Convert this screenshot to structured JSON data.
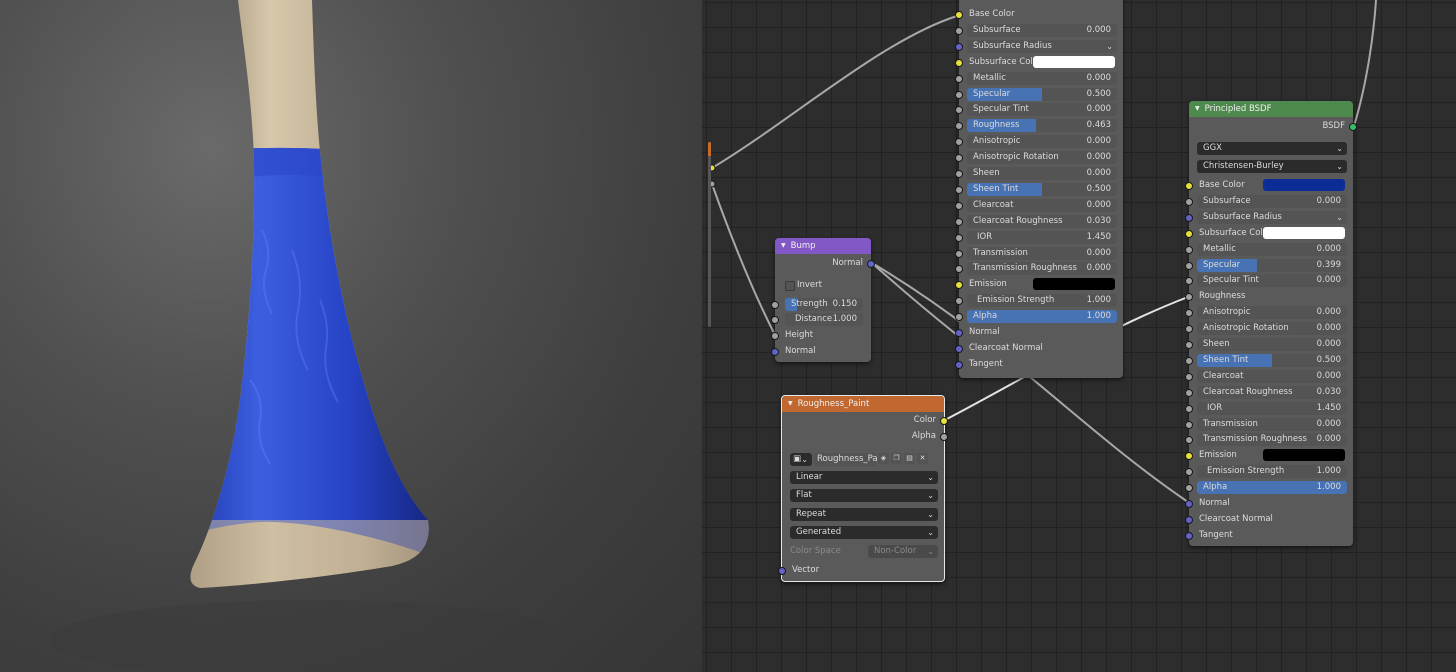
{
  "colors": {
    "bump_header": "#8257c6",
    "roughness_header": "#c0682f",
    "principled_header": "#4e8a4e",
    "accent_fill": "#4772b3",
    "base_color_swatch": "#0d2d96"
  },
  "principled_left": {
    "rows": [
      {
        "label": "Base Color",
        "socket": "yellow",
        "kind": "socket"
      },
      {
        "label": "Subsurface",
        "value": "0.000",
        "socket": "gray",
        "kind": "field",
        "fill": 0
      },
      {
        "label": "Subsurface Radius",
        "socket": "purple",
        "kind": "dropdown"
      },
      {
        "label": "Subsurface Col",
        "socket": "yellow",
        "kind": "color",
        "color": "#ffffff"
      },
      {
        "label": "Metallic",
        "value": "0.000",
        "socket": "gray",
        "kind": "field",
        "fill": 0
      },
      {
        "label": "Specular",
        "value": "0.500",
        "socket": "gray",
        "kind": "field",
        "fill": 0.5
      },
      {
        "label": "Specular Tint",
        "value": "0.000",
        "socket": "gray",
        "kind": "field",
        "fill": 0
      },
      {
        "label": "Roughness",
        "value": "0.463",
        "socket": "gray",
        "kind": "field",
        "fill": 0.463
      },
      {
        "label": "Anisotropic",
        "value": "0.000",
        "socket": "gray",
        "kind": "field",
        "fill": 0
      },
      {
        "label": "Anisotropic Rotation",
        "value": "0.000",
        "socket": "gray",
        "kind": "field",
        "fill": 0
      },
      {
        "label": "Sheen",
        "value": "0.000",
        "socket": "gray",
        "kind": "field",
        "fill": 0
      },
      {
        "label": "Sheen Tint",
        "value": "0.500",
        "socket": "gray",
        "kind": "field",
        "fill": 0.5
      },
      {
        "label": "Clearcoat",
        "value": "0.000",
        "socket": "gray",
        "kind": "field",
        "fill": 0
      },
      {
        "label": "Clearcoat Roughness",
        "value": "0.030",
        "socket": "gray",
        "kind": "field",
        "fill": 0
      },
      {
        "label": "IOR",
        "value": "1.450",
        "socket": "gray",
        "kind": "field",
        "fill": 0
      },
      {
        "label": "Transmission",
        "value": "0.000",
        "socket": "gray",
        "kind": "field",
        "fill": 0
      },
      {
        "label": "Transmission Roughness",
        "value": "0.000",
        "socket": "gray",
        "kind": "field",
        "fill": 0
      },
      {
        "label": "Emission",
        "socket": "yellow",
        "kind": "color",
        "color": "#000000"
      },
      {
        "label": "Emission Strength",
        "value": "1.000",
        "socket": "gray",
        "kind": "field",
        "fill": 0
      },
      {
        "label": "Alpha",
        "value": "1.000",
        "socket": "gray",
        "kind": "field",
        "fill": 1
      },
      {
        "label": "Normal",
        "socket": "purple",
        "kind": "socket"
      },
      {
        "label": "Clearcoat Normal",
        "socket": "purple",
        "kind": "socket"
      },
      {
        "label": "Tangent",
        "socket": "purple",
        "kind": "socket"
      }
    ]
  },
  "bump": {
    "title": "Bump",
    "output_normal": "Normal",
    "invert": "Invert",
    "strength_label": "Strength",
    "strength_value": "0.150",
    "strength_fill": 0.15,
    "distance_label": "Distance",
    "distance_value": "1.000",
    "height": "Height",
    "normal": "Normal"
  },
  "roughness_paint": {
    "title": "Roughness_Paint",
    "output_color": "Color",
    "output_alpha": "Alpha",
    "image_name": "Roughness_Pai..",
    "interpolation": "Linear",
    "projection": "Flat",
    "extension": "Repeat",
    "source": "Generated",
    "color_space_label": "Color Space",
    "color_space_value": "Non-Color",
    "vector": "Vector"
  },
  "principled_right": {
    "title": "Principled BSDF",
    "output": "BSDF",
    "distribution": "GGX",
    "subsurface_method": "Christensen-Burley",
    "rows": [
      {
        "label": "Base Color",
        "socket": "yellow",
        "kind": "color",
        "color": "#0d2d96"
      },
      {
        "label": "Subsurface",
        "value": "0.000",
        "socket": "gray",
        "kind": "field",
        "fill": 0
      },
      {
        "label": "Subsurface Radius",
        "socket": "purple",
        "kind": "dropdown"
      },
      {
        "label": "Subsurface Col",
        "socket": "yellow",
        "kind": "color",
        "color": "#ffffff"
      },
      {
        "label": "Metallic",
        "value": "0.000",
        "socket": "gray",
        "kind": "field",
        "fill": 0
      },
      {
        "label": "Specular",
        "value": "0.399",
        "socket": "gray",
        "kind": "field",
        "fill": 0.399
      },
      {
        "label": "Specular Tint",
        "value": "0.000",
        "socket": "gray",
        "kind": "field",
        "fill": 0
      },
      {
        "label": "Roughness",
        "socket": "gray",
        "kind": "socket"
      },
      {
        "label": "Anisotropic",
        "value": "0.000",
        "socket": "gray",
        "kind": "field",
        "fill": 0
      },
      {
        "label": "Anisotropic Rotation",
        "value": "0.000",
        "socket": "gray",
        "kind": "field",
        "fill": 0
      },
      {
        "label": "Sheen",
        "value": "0.000",
        "socket": "gray",
        "kind": "field",
        "fill": 0
      },
      {
        "label": "Sheen Tint",
        "value": "0.500",
        "socket": "gray",
        "kind": "field",
        "fill": 0.5
      },
      {
        "label": "Clearcoat",
        "value": "0.000",
        "socket": "gray",
        "kind": "field",
        "fill": 0
      },
      {
        "label": "Clearcoat Roughness",
        "value": "0.030",
        "socket": "gray",
        "kind": "field",
        "fill": 0
      },
      {
        "label": "IOR",
        "value": "1.450",
        "socket": "gray",
        "kind": "field",
        "fill": 0
      },
      {
        "label": "Transmission",
        "value": "0.000",
        "socket": "gray",
        "kind": "field",
        "fill": 0
      },
      {
        "label": "Transmission Roughness",
        "value": "0.000",
        "socket": "gray",
        "kind": "field",
        "fill": 0
      },
      {
        "label": "Emission",
        "socket": "yellow",
        "kind": "color",
        "color": "#000000"
      },
      {
        "label": "Emission Strength",
        "value": "1.000",
        "socket": "gray",
        "kind": "field",
        "fill": 0
      },
      {
        "label": "Alpha",
        "value": "1.000",
        "socket": "gray",
        "kind": "field",
        "fill": 1
      },
      {
        "label": "Normal",
        "socket": "purple",
        "kind": "socket"
      },
      {
        "label": "Clearcoat Normal",
        "socket": "purple",
        "kind": "socket"
      },
      {
        "label": "Tangent",
        "socket": "purple",
        "kind": "socket"
      }
    ]
  }
}
